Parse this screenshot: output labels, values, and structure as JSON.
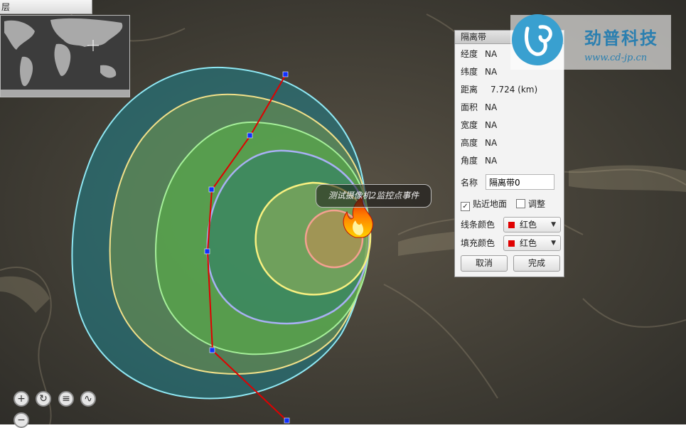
{
  "layer_tab": {
    "label": "层"
  },
  "event_callout": {
    "text": "测试摄像机2监控点事件"
  },
  "panel": {
    "title": "隔离带",
    "fields": [
      {
        "label": "经度",
        "value": "NA"
      },
      {
        "label": "纬度",
        "value": "NA"
      },
      {
        "label": "距离",
        "value": "7.724 (km)"
      },
      {
        "label": "面积",
        "value": "NA"
      },
      {
        "label": "宽度",
        "value": "NA"
      },
      {
        "label": "高度",
        "value": "NA"
      },
      {
        "label": "角度",
        "value": "NA"
      }
    ],
    "name_label": "名称",
    "name_value": "隔离带0",
    "snap_ground": {
      "label": "贴近地面",
      "checked": true
    },
    "adjust": {
      "label": "调整",
      "checked": false
    },
    "line_color": {
      "label": "线条颜色",
      "value": "红色",
      "swatch": "#e00000"
    },
    "fill_color": {
      "label": "填充颜色",
      "value": "红色",
      "swatch": "#e00000"
    },
    "cancel_label": "取消",
    "done_label": "完成"
  },
  "logo": {
    "name": "劲普科技",
    "url": "www.cd-jp.cn",
    "color": "#2a7fb0"
  },
  "buffer_ring_colors": [
    "#7fe0f0",
    "#f0e08a",
    "#a6f09a",
    "#a0a8f0",
    "#f8f080",
    "#f4a090"
  ],
  "isolation_line_color": "#e00000",
  "map_controls": [
    "zoom-in-icon",
    "rotate-icon",
    "layers-icon",
    "terrain-icon",
    "zoom-out-icon"
  ]
}
